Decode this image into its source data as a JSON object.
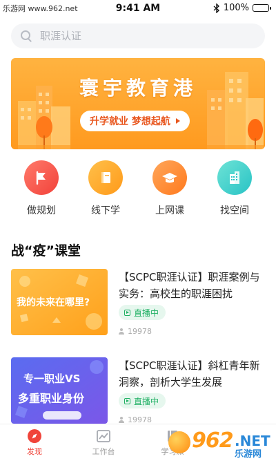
{
  "status_bar": {
    "watermark": "乐游网 www.962.net",
    "time": "9:41 AM",
    "battery": "100%",
    "battery_level": 1.0
  },
  "search": {
    "placeholder": "职涯认证"
  },
  "banner": {
    "title": "寰宇教育港",
    "slogan": "升学就业  梦想起航"
  },
  "quick_entries": [
    {
      "label": "做规划",
      "icon": "flag-icon",
      "color": "#f2423a"
    },
    {
      "label": "线下学",
      "icon": "book-icon",
      "color": "#ff9a1a"
    },
    {
      "label": "上网课",
      "icon": "graduation-cap-icon",
      "color": "#ff7a1e"
    },
    {
      "label": "找空间",
      "icon": "building-icon",
      "color": "#28c3c5"
    }
  ],
  "section": {
    "title": "战“疫”课堂"
  },
  "courses": [
    {
      "thumb_text": "我的未来在哪里?",
      "title": "【SCPC职涯认证】职涯案例与实务：高校生的职涯困扰",
      "status": "直播中",
      "views": "19978"
    },
    {
      "thumb_text_1": "专一职业VS",
      "thumb_text_2": "多重职业身份",
      "title": "【SCPC职涯认证】斜杠青年新洞察，剖析大学生发展",
      "status": "直播中",
      "views": "19978"
    }
  ],
  "tabbar": {
    "tabs": [
      {
        "label": "发现",
        "icon": "compass-icon",
        "active": true
      },
      {
        "label": "工作台",
        "icon": "chart-icon",
        "active": false
      },
      {
        "label": "学习派",
        "icon": "book-icon",
        "active": false
      }
    ]
  },
  "watermark_footer": {
    "number": "962",
    "net": ".NET",
    "cn": "乐游网"
  },
  "colors": {
    "accent": "#f0443a",
    "live_green": "#20b064",
    "banner_orange": "#ff9a1f"
  }
}
